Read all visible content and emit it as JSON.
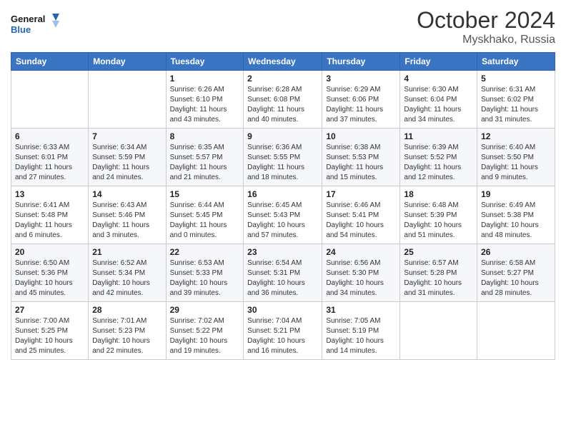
{
  "header": {
    "logo_line1": "General",
    "logo_line2": "Blue",
    "month": "October 2024",
    "location": "Myskhako, Russia"
  },
  "weekdays": [
    "Sunday",
    "Monday",
    "Tuesday",
    "Wednesday",
    "Thursday",
    "Friday",
    "Saturday"
  ],
  "weeks": [
    [
      {
        "day": "",
        "info": ""
      },
      {
        "day": "",
        "info": ""
      },
      {
        "day": "1",
        "info": "Sunrise: 6:26 AM\nSunset: 6:10 PM\nDaylight: 11 hours and 43 minutes."
      },
      {
        "day": "2",
        "info": "Sunrise: 6:28 AM\nSunset: 6:08 PM\nDaylight: 11 hours and 40 minutes."
      },
      {
        "day": "3",
        "info": "Sunrise: 6:29 AM\nSunset: 6:06 PM\nDaylight: 11 hours and 37 minutes."
      },
      {
        "day": "4",
        "info": "Sunrise: 6:30 AM\nSunset: 6:04 PM\nDaylight: 11 hours and 34 minutes."
      },
      {
        "day": "5",
        "info": "Sunrise: 6:31 AM\nSunset: 6:02 PM\nDaylight: 11 hours and 31 minutes."
      }
    ],
    [
      {
        "day": "6",
        "info": "Sunrise: 6:33 AM\nSunset: 6:01 PM\nDaylight: 11 hours and 27 minutes."
      },
      {
        "day": "7",
        "info": "Sunrise: 6:34 AM\nSunset: 5:59 PM\nDaylight: 11 hours and 24 minutes."
      },
      {
        "day": "8",
        "info": "Sunrise: 6:35 AM\nSunset: 5:57 PM\nDaylight: 11 hours and 21 minutes."
      },
      {
        "day": "9",
        "info": "Sunrise: 6:36 AM\nSunset: 5:55 PM\nDaylight: 11 hours and 18 minutes."
      },
      {
        "day": "10",
        "info": "Sunrise: 6:38 AM\nSunset: 5:53 PM\nDaylight: 11 hours and 15 minutes."
      },
      {
        "day": "11",
        "info": "Sunrise: 6:39 AM\nSunset: 5:52 PM\nDaylight: 11 hours and 12 minutes."
      },
      {
        "day": "12",
        "info": "Sunrise: 6:40 AM\nSunset: 5:50 PM\nDaylight: 11 hours and 9 minutes."
      }
    ],
    [
      {
        "day": "13",
        "info": "Sunrise: 6:41 AM\nSunset: 5:48 PM\nDaylight: 11 hours and 6 minutes."
      },
      {
        "day": "14",
        "info": "Sunrise: 6:43 AM\nSunset: 5:46 PM\nDaylight: 11 hours and 3 minutes."
      },
      {
        "day": "15",
        "info": "Sunrise: 6:44 AM\nSunset: 5:45 PM\nDaylight: 11 hours and 0 minutes."
      },
      {
        "day": "16",
        "info": "Sunrise: 6:45 AM\nSunset: 5:43 PM\nDaylight: 10 hours and 57 minutes."
      },
      {
        "day": "17",
        "info": "Sunrise: 6:46 AM\nSunset: 5:41 PM\nDaylight: 10 hours and 54 minutes."
      },
      {
        "day": "18",
        "info": "Sunrise: 6:48 AM\nSunset: 5:39 PM\nDaylight: 10 hours and 51 minutes."
      },
      {
        "day": "19",
        "info": "Sunrise: 6:49 AM\nSunset: 5:38 PM\nDaylight: 10 hours and 48 minutes."
      }
    ],
    [
      {
        "day": "20",
        "info": "Sunrise: 6:50 AM\nSunset: 5:36 PM\nDaylight: 10 hours and 45 minutes."
      },
      {
        "day": "21",
        "info": "Sunrise: 6:52 AM\nSunset: 5:34 PM\nDaylight: 10 hours and 42 minutes."
      },
      {
        "day": "22",
        "info": "Sunrise: 6:53 AM\nSunset: 5:33 PM\nDaylight: 10 hours and 39 minutes."
      },
      {
        "day": "23",
        "info": "Sunrise: 6:54 AM\nSunset: 5:31 PM\nDaylight: 10 hours and 36 minutes."
      },
      {
        "day": "24",
        "info": "Sunrise: 6:56 AM\nSunset: 5:30 PM\nDaylight: 10 hours and 34 minutes."
      },
      {
        "day": "25",
        "info": "Sunrise: 6:57 AM\nSunset: 5:28 PM\nDaylight: 10 hours and 31 minutes."
      },
      {
        "day": "26",
        "info": "Sunrise: 6:58 AM\nSunset: 5:27 PM\nDaylight: 10 hours and 28 minutes."
      }
    ],
    [
      {
        "day": "27",
        "info": "Sunrise: 7:00 AM\nSunset: 5:25 PM\nDaylight: 10 hours and 25 minutes."
      },
      {
        "day": "28",
        "info": "Sunrise: 7:01 AM\nSunset: 5:23 PM\nDaylight: 10 hours and 22 minutes."
      },
      {
        "day": "29",
        "info": "Sunrise: 7:02 AM\nSunset: 5:22 PM\nDaylight: 10 hours and 19 minutes."
      },
      {
        "day": "30",
        "info": "Sunrise: 7:04 AM\nSunset: 5:21 PM\nDaylight: 10 hours and 16 minutes."
      },
      {
        "day": "31",
        "info": "Sunrise: 7:05 AM\nSunset: 5:19 PM\nDaylight: 10 hours and 14 minutes."
      },
      {
        "day": "",
        "info": ""
      },
      {
        "day": "",
        "info": ""
      }
    ]
  ]
}
